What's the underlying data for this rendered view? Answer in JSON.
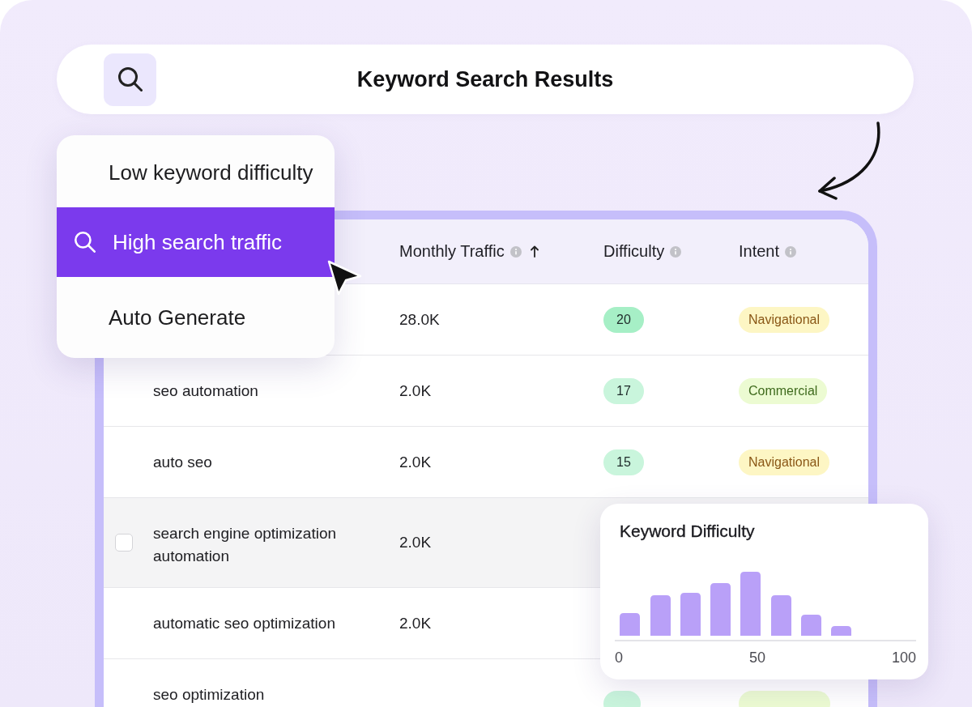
{
  "title_bar": {
    "title": "Keyword Search Results"
  },
  "dropdown": {
    "items": [
      {
        "label": "Low keyword difficulty",
        "selected": false
      },
      {
        "label": "High search traffic",
        "selected": true
      },
      {
        "label": "Auto Generate",
        "selected": false
      }
    ]
  },
  "table": {
    "columns": [
      {
        "label": "Monthly Traffic",
        "info": true,
        "sorted": true
      },
      {
        "label": "Difficulty",
        "info": true,
        "sorted": false
      },
      {
        "label": "Intent",
        "info": true,
        "sorted": false
      }
    ],
    "rows": [
      {
        "traffic": "28.0K",
        "difficulty": {
          "value": "20",
          "color": "#a6efc6"
        },
        "intent": {
          "label": "Navigational",
          "kind": "navigational"
        },
        "hovered": false,
        "checked": false
      },
      {
        "keyword": "seo automation",
        "traffic": "2.0K",
        "difficulty": {
          "value": "17",
          "color": "#c9f5dc"
        },
        "intent": {
          "label": "Commercial",
          "kind": "commercial"
        },
        "hovered": false,
        "checked": false
      },
      {
        "keyword": "auto seo",
        "traffic": "2.0K",
        "difficulty": {
          "value": "15",
          "color": "#c9f5dc"
        },
        "intent": {
          "label": "Navigational",
          "kind": "navigational"
        },
        "hovered": false,
        "checked": false
      },
      {
        "keyword": "search engine optimization automation",
        "traffic": "2.0K",
        "hovered": true,
        "checked": false
      },
      {
        "keyword": "automatic seo optimization",
        "traffic": "2.0K",
        "hovered": false,
        "checked": false
      },
      {
        "keyword": "seo optimization",
        "difficulty": {
          "color": "#c9f5dc"
        },
        "intent": {
          "kind": "commercial"
        },
        "hovered": false,
        "checked": false
      }
    ]
  },
  "chart_card": {
    "title": "Keyword Difficulty",
    "tick_labels": [
      "0",
      "50",
      "100"
    ]
  }
}
